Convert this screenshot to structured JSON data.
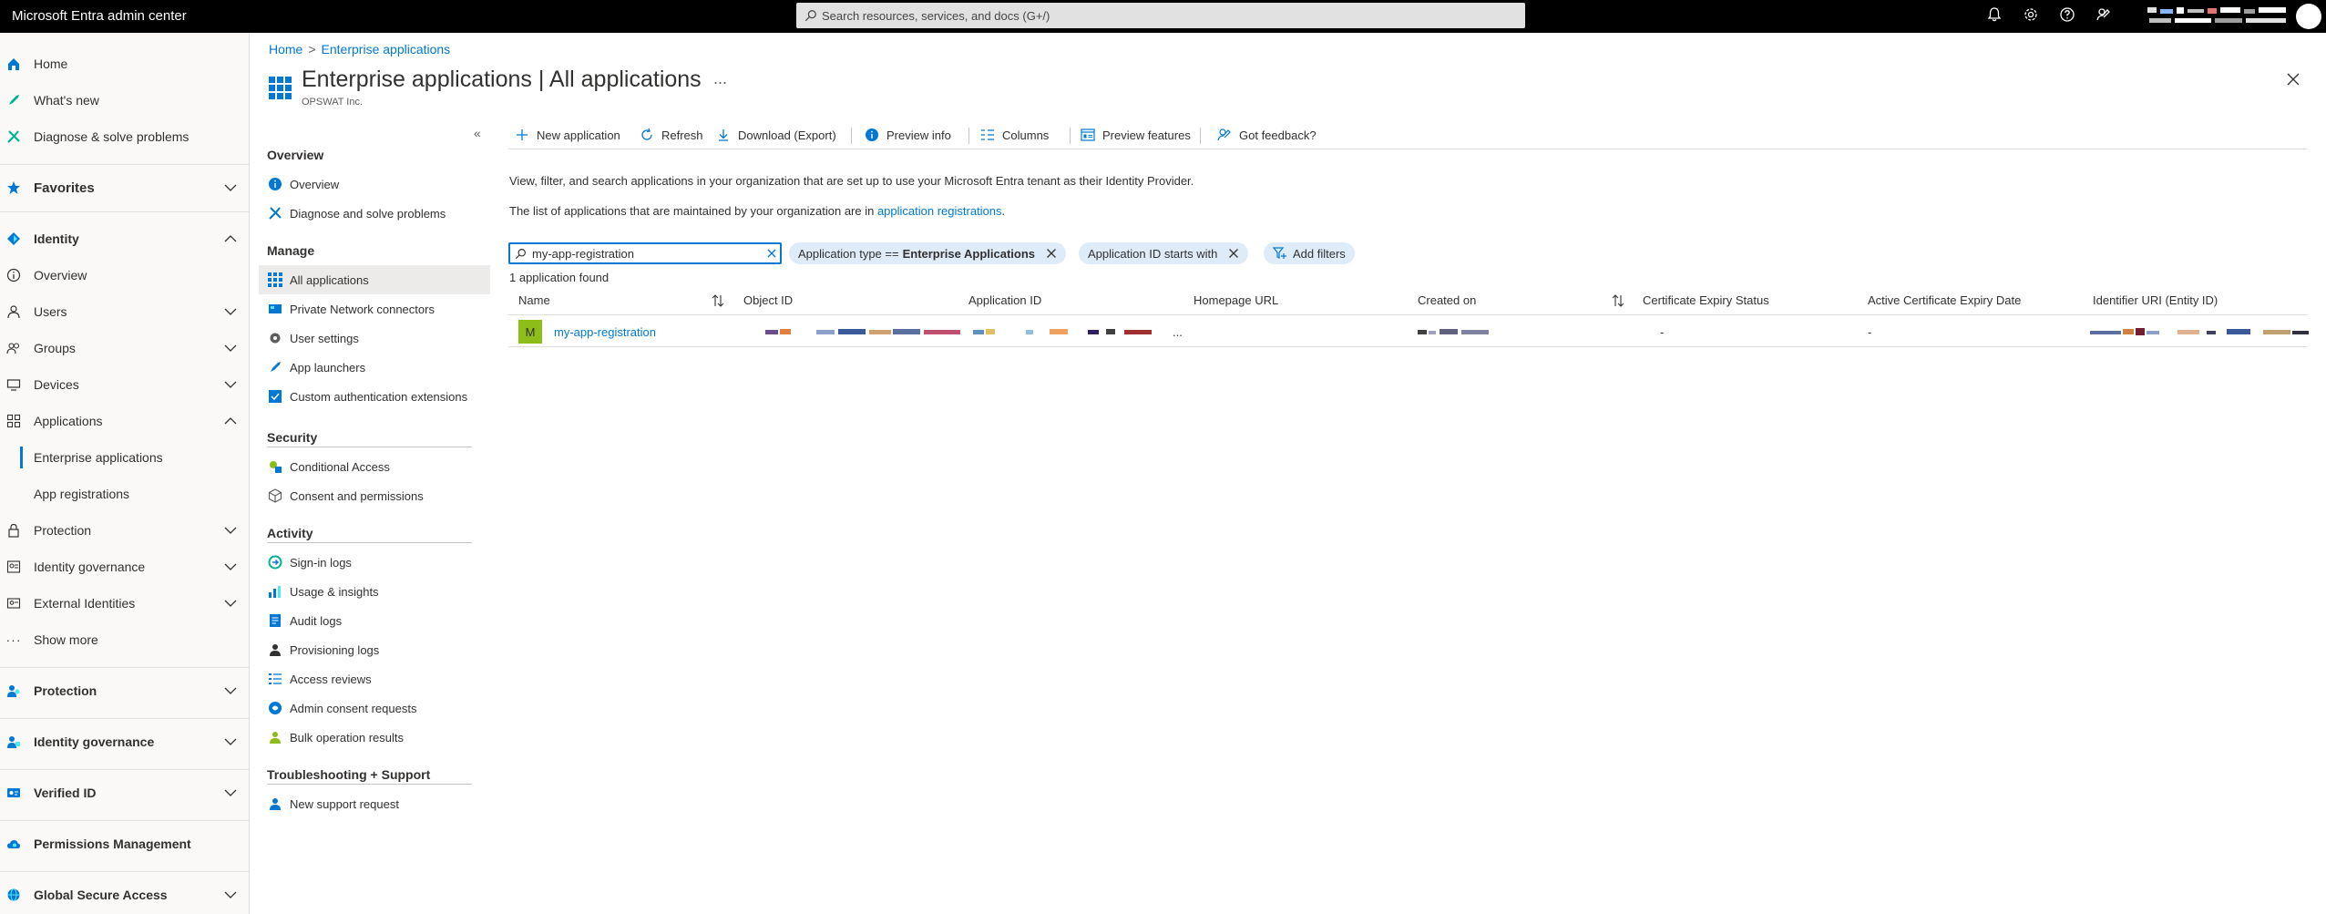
{
  "topbar": {
    "brand": "Microsoft Entra admin center",
    "search_placeholder": "Search resources, services, and docs (G+/)"
  },
  "nav": {
    "items": [
      {
        "label": "Home",
        "icon": "home-icon"
      },
      {
        "label": "What's new",
        "icon": "rocket-icon"
      },
      {
        "label": "Diagnose & solve problems",
        "icon": "wrench-icon"
      },
      {
        "label": "Favorites",
        "icon": "star-icon"
      },
      {
        "label": "Identity",
        "icon": "identity-diamond-icon"
      },
      {
        "label": "Overview",
        "icon": "info-circle-icon"
      },
      {
        "label": "Users",
        "icon": "user-icon"
      },
      {
        "label": "Groups",
        "icon": "group-icon"
      },
      {
        "label": "Devices",
        "icon": "device-icon"
      },
      {
        "label": "Applications",
        "icon": "applications-icon"
      },
      {
        "label": "Enterprise applications"
      },
      {
        "label": "App registrations"
      },
      {
        "label": "Protection",
        "icon": "lock-icon"
      },
      {
        "label": "Identity governance",
        "icon": "governance-icon"
      },
      {
        "label": "External Identities",
        "icon": "external-identities-icon"
      },
      {
        "label": "Show more",
        "icon": "ellipsis-icon"
      },
      {
        "label": "Protection",
        "icon": "protection-icon"
      },
      {
        "label": "Identity governance",
        "icon": "identity-governance-icon"
      },
      {
        "label": "Verified ID",
        "icon": "verified-id-icon"
      },
      {
        "label": "Permissions Management",
        "icon": "cloud-icon"
      },
      {
        "label": "Global Secure Access",
        "icon": "globe-icon"
      }
    ]
  },
  "breadcrumb": {
    "home": "Home",
    "sep": ">",
    "current": "Enterprise applications"
  },
  "page": {
    "title": "Enterprise applications | All applications",
    "subtitle": "OPSWAT Inc.",
    "more": "...",
    "collapse": "«"
  },
  "resource_menu": {
    "overview_header": "Overview",
    "manage_header": "Manage",
    "security_header": "Security",
    "activity_header": "Activity",
    "troubleshooting_header": "Troubleshooting + Support",
    "items": {
      "overview": "Overview",
      "diagnose": "Diagnose and solve problems",
      "all_apps": "All applications",
      "private_network": "Private Network connectors",
      "user_settings": "User settings",
      "app_launchers": "App launchers",
      "custom_auth": "Custom authentication extensions",
      "conditional_access": "Conditional Access",
      "consent": "Consent and permissions",
      "signin_logs": "Sign-in logs",
      "usage": "Usage & insights",
      "audit_logs": "Audit logs",
      "provisioning_logs": "Provisioning logs",
      "access_reviews": "Access reviews",
      "admin_consent": "Admin consent requests",
      "bulk_results": "Bulk operation results",
      "support_request": "New support request"
    }
  },
  "toolbar": {
    "new_app": "New application",
    "refresh": "Refresh",
    "download": "Download (Export)",
    "preview_info": "Preview info",
    "columns": "Columns",
    "preview_features": "Preview features",
    "feedback": "Got feedback?"
  },
  "content": {
    "desc1": "View, filter, and search applications in your organization that are set up to use your Microsoft Entra tenant as their Identity Provider.",
    "desc2_prefix": "The list of applications that are maintained by your organization are in ",
    "desc2_link": "application registrations",
    "desc2_suffix": ".",
    "search_value": "my-app-registration",
    "pill1_label": "Application type ==",
    "pill1_value": "Enterprise Applications",
    "pill2_label": "Application ID starts with",
    "add_filters": "Add filters",
    "found": "1 application found"
  },
  "table": {
    "columns": [
      "Name",
      "Object ID",
      "Application ID",
      "Homepage URL",
      "Created on",
      "Certificate Expiry Status",
      "Active Certificate Expiry Date",
      "Identifier URI (Entity ID)"
    ],
    "row": {
      "initial": "M",
      "name": "my-app-registration",
      "homepage": "...",
      "cert_status": "-",
      "cert_date": "-"
    }
  },
  "colors": {
    "accent": "#0078d4",
    "topbar": "#000000",
    "app_icon": "#8cbd18",
    "pill": "#deecf9"
  }
}
